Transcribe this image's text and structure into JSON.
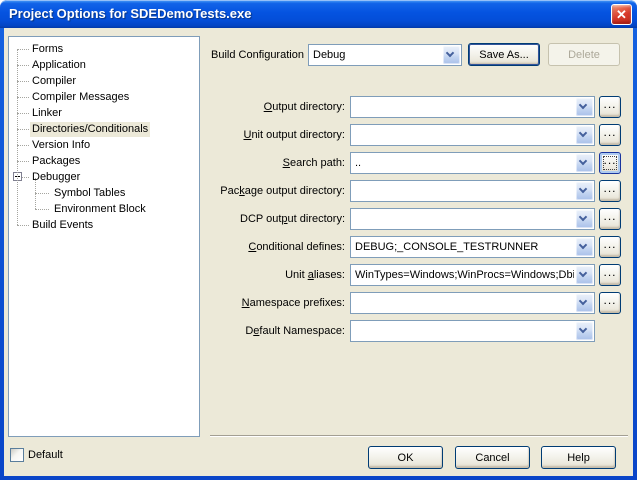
{
  "window": {
    "title": "Project Options for SDEDemoTests.exe",
    "close_glyph": "✕"
  },
  "colors": {
    "titlebar_top": "#3589F2",
    "titlebar_bottom": "#0339A8",
    "client_bg": "#ECE9D8",
    "close_button_red": "#D83A2B",
    "selection_bg": "#ECE9D8",
    "combo_border": "#7F9DB9",
    "button_border": "#003C74"
  },
  "build_config": {
    "label": "Build Configuration",
    "value": "Debug",
    "save_as_label": "Save As...",
    "delete_label": "Delete"
  },
  "tree": {
    "collapse_icon": "minus-box",
    "items": [
      {
        "name": "forms",
        "label": "Forms",
        "level": 0
      },
      {
        "name": "application",
        "label": "Application",
        "level": 0
      },
      {
        "name": "compiler",
        "label": "Compiler",
        "level": 0
      },
      {
        "name": "compiler-messages",
        "label": "Compiler Messages",
        "level": 0
      },
      {
        "name": "linker",
        "label": "Linker",
        "level": 0
      },
      {
        "name": "directories-conditionals",
        "label": "Directories/Conditionals",
        "level": 0,
        "selected": true
      },
      {
        "name": "version-info",
        "label": "Version Info",
        "level": 0
      },
      {
        "name": "packages",
        "label": "Packages",
        "level": 0
      },
      {
        "name": "debugger",
        "label": "Debugger",
        "level": 0,
        "expanded": true
      },
      {
        "name": "symbol-tables",
        "label": "Symbol Tables",
        "level": 1
      },
      {
        "name": "environment-block",
        "label": "Environment Block",
        "level": 1
      },
      {
        "name": "build-events",
        "label": "Build Events",
        "level": 0
      }
    ]
  },
  "fields": {
    "browse_label": "...",
    "rows": [
      {
        "name": "output-directory",
        "pre": "",
        "accel": "O",
        "post": "utput directory:",
        "value": "",
        "browse": true
      },
      {
        "name": "unit-output-directory",
        "pre": "",
        "accel": "U",
        "post": "nit output directory:",
        "value": "",
        "browse": true
      },
      {
        "name": "search-path",
        "pre": "",
        "accel": "S",
        "post": "earch path:",
        "value": "..",
        "browse": true,
        "browse_focused": true
      },
      {
        "name": "package-output-directory",
        "pre": "Pac",
        "accel": "k",
        "post": "age output directory:",
        "value": "",
        "browse": true
      },
      {
        "name": "dcp-output-directory",
        "pre": "DCP out",
        "accel": "p",
        "post": "ut directory:",
        "value": "",
        "browse": true
      },
      {
        "name": "conditional-defines",
        "pre": "",
        "accel": "C",
        "post": "onditional defines:",
        "value": "DEBUG;_CONSOLE_TESTRUNNER",
        "browse": true
      },
      {
        "name": "unit-aliases",
        "pre": "Unit ",
        "accel": "a",
        "post": "liases:",
        "value": "WinTypes=Windows;WinProcs=Windows;DbiT",
        "browse": true
      },
      {
        "name": "namespace-prefixes",
        "pre": "",
        "accel": "N",
        "post": "amespace prefixes:",
        "value": "",
        "browse": true
      },
      {
        "name": "default-namespace",
        "pre": "D",
        "accel": "e",
        "post": "fault Namespace:",
        "value": "",
        "browse": false
      }
    ]
  },
  "footer": {
    "default_label": "Default",
    "ok_label": "OK",
    "cancel_label": "Cancel",
    "help_label": "Help"
  }
}
